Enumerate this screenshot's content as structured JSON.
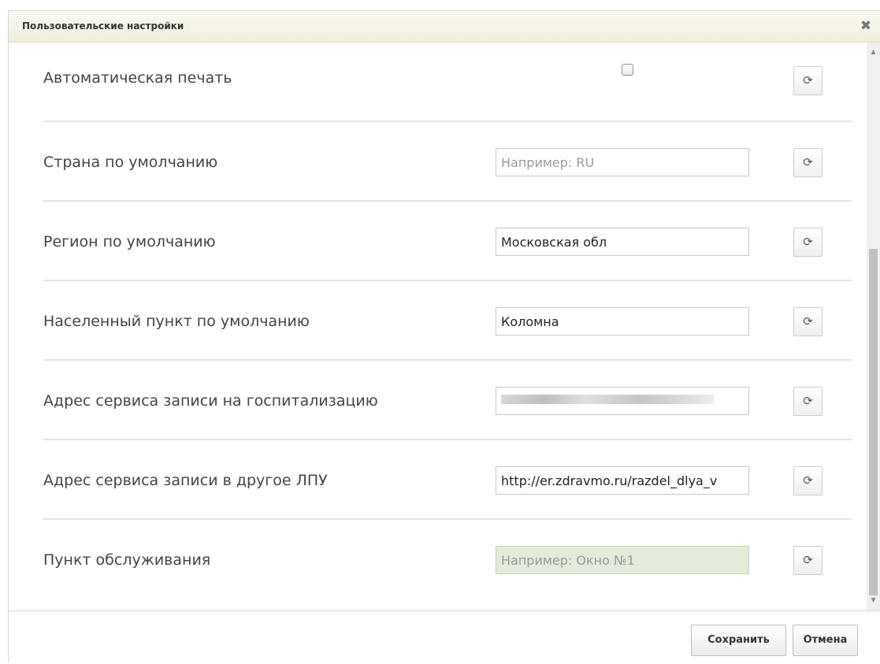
{
  "dialog": {
    "title": "Пользовательские настройки",
    "close_glyph": "✖",
    "close_icon": "close-icon"
  },
  "settings": [
    {
      "label": "Автоматическая печать",
      "control": "checkbox",
      "checked": false
    },
    {
      "label": "Страна по умолчанию",
      "control": "input",
      "value": "",
      "placeholder": "Например: RU"
    },
    {
      "label": "Регион по умолчанию",
      "control": "input",
      "value": "Московская обл",
      "placeholder": ""
    },
    {
      "label": "Населенный пункт по умолчанию",
      "control": "input",
      "value": "Коломна",
      "placeholder": ""
    },
    {
      "label": "Адрес сервиса записи на госпитализацию",
      "control": "input",
      "value": "",
      "placeholder": "",
      "blurred": true
    },
    {
      "label": "Адрес сервиса записи в другое ЛПУ",
      "control": "input",
      "value": "http://er.zdravmo.ru/razdel_dlya_v",
      "placeholder": ""
    },
    {
      "label": "Пункт обслуживания",
      "control": "input",
      "value": "",
      "placeholder": "Например: Окно №1",
      "highlight_color": "#e3ecdb"
    }
  ],
  "reset_icon": "reset-icon",
  "reset_glyph": "⟳",
  "scrollbar": {
    "up_glyph": "▲",
    "down_glyph": "▼"
  },
  "footer": {
    "save_label": "Сохранить",
    "cancel_label": "Отмена"
  }
}
